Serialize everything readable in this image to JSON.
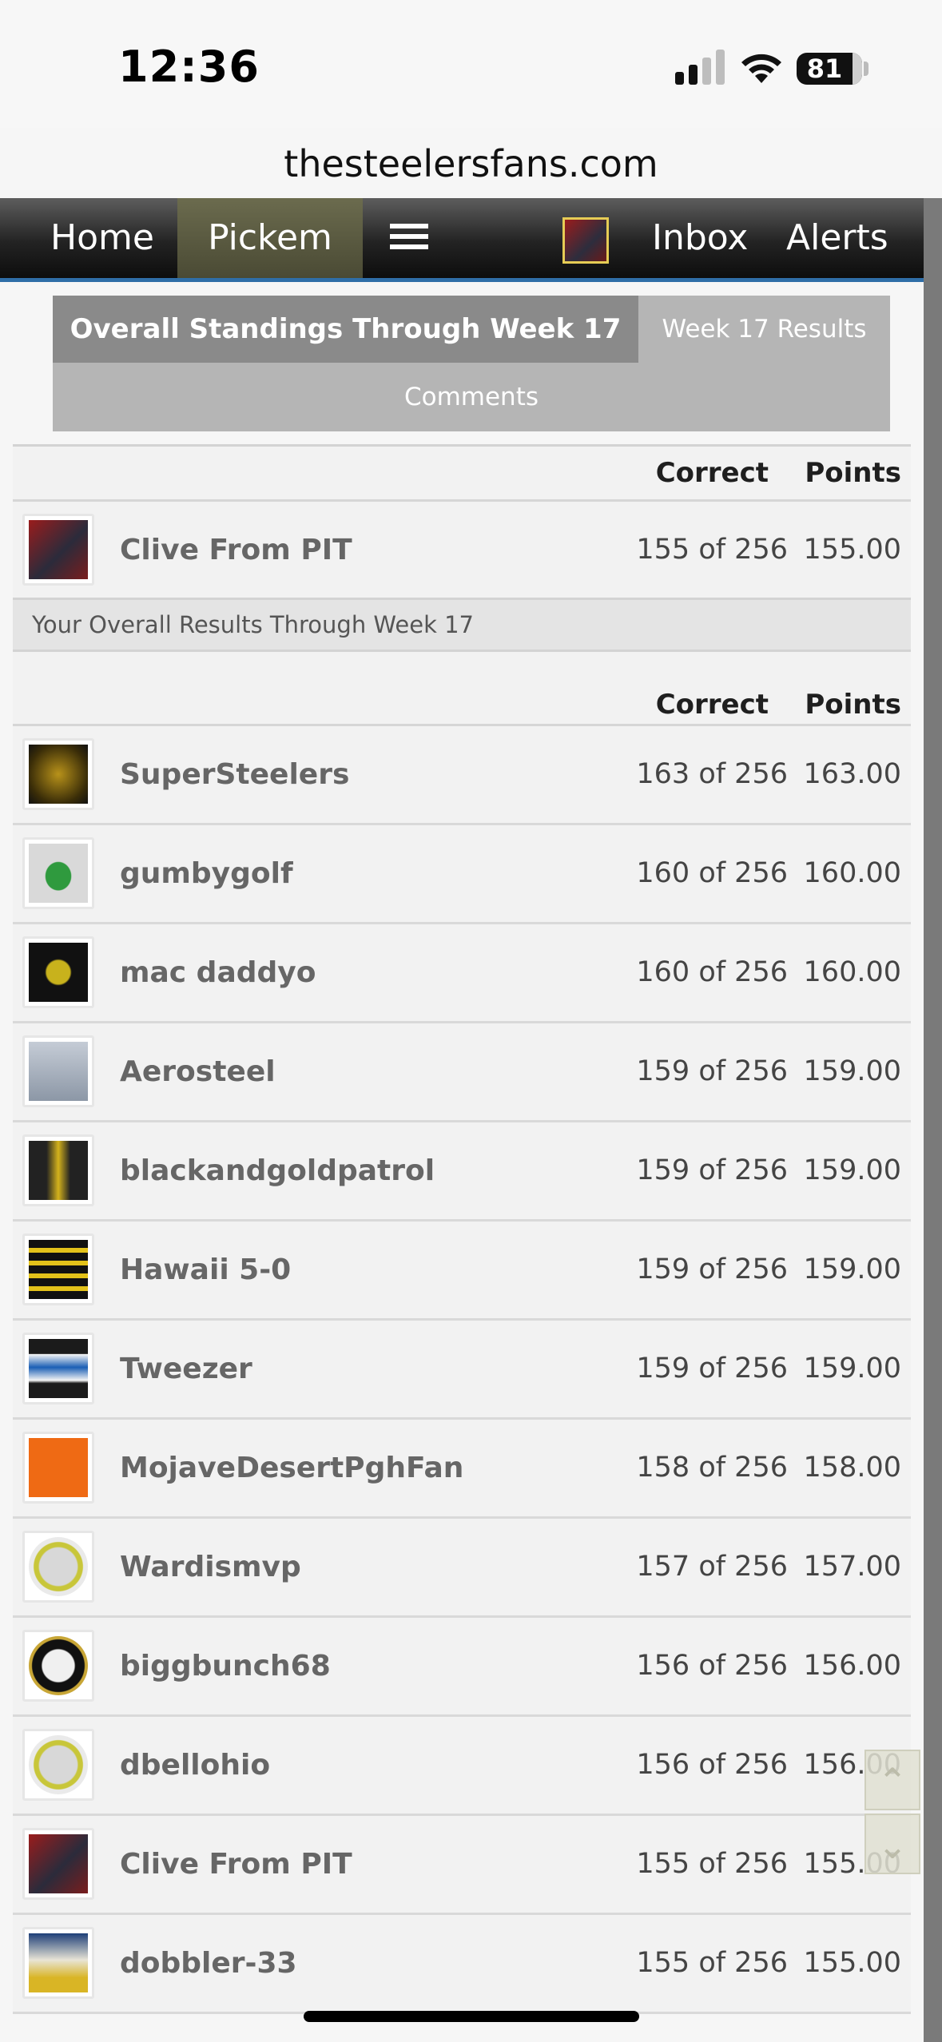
{
  "status_bar": {
    "time": "12:36",
    "battery": "81"
  },
  "browser": {
    "url": "thesteelersfans.com"
  },
  "nav": {
    "home": "Home",
    "pickem": "Pickem",
    "inbox": "Inbox",
    "alerts": "Alerts",
    "menu_icon": "hamburger-menu-icon"
  },
  "tabs": {
    "overall": "Overall Standings Through Week 17",
    "week": "Week 17 Results",
    "comments": "Comments"
  },
  "columns": {
    "correct": "Correct",
    "points": "Points"
  },
  "my_result": {
    "name": "Clive From PIT",
    "correct": "155 of 256",
    "points": "155.00"
  },
  "overall_label": "Your Overall Results Through Week 17",
  "standings": [
    {
      "name": "SuperSteelers",
      "correct": "163 of 256",
      "points": "163.00"
    },
    {
      "name": "gumbygolf",
      "correct": "160 of 256",
      "points": "160.00"
    },
    {
      "name": "mac daddyo",
      "correct": "160 of 256",
      "points": "160.00"
    },
    {
      "name": "Aerosteel",
      "correct": "159 of 256",
      "points": "159.00"
    },
    {
      "name": "blackandgoldpatrol",
      "correct": "159 of 256",
      "points": "159.00"
    },
    {
      "name": "Hawaii 5-0",
      "correct": "159 of 256",
      "points": "159.00"
    },
    {
      "name": "Tweezer",
      "correct": "159 of 256",
      "points": "159.00"
    },
    {
      "name": "MojaveDesertPghFan",
      "correct": "158 of 256",
      "points": "158.00"
    },
    {
      "name": "Wardismvp",
      "correct": "157 of 256",
      "points": "157.00"
    },
    {
      "name": "biggbunch68",
      "correct": "156 of 256",
      "points": "156.00"
    },
    {
      "name": "dbellohio",
      "correct": "156 of 256",
      "points": "156.00"
    },
    {
      "name": "Clive From PIT",
      "correct": "155 of 256",
      "points": "155.00"
    },
    {
      "name": "dobbler-33",
      "correct": "155 of 256",
      "points": "155.00"
    }
  ],
  "colors": {
    "nav_accent": "#2f6ea7",
    "pickem_tab": "#5c5c42",
    "tab_active": "#8a8a8a"
  }
}
